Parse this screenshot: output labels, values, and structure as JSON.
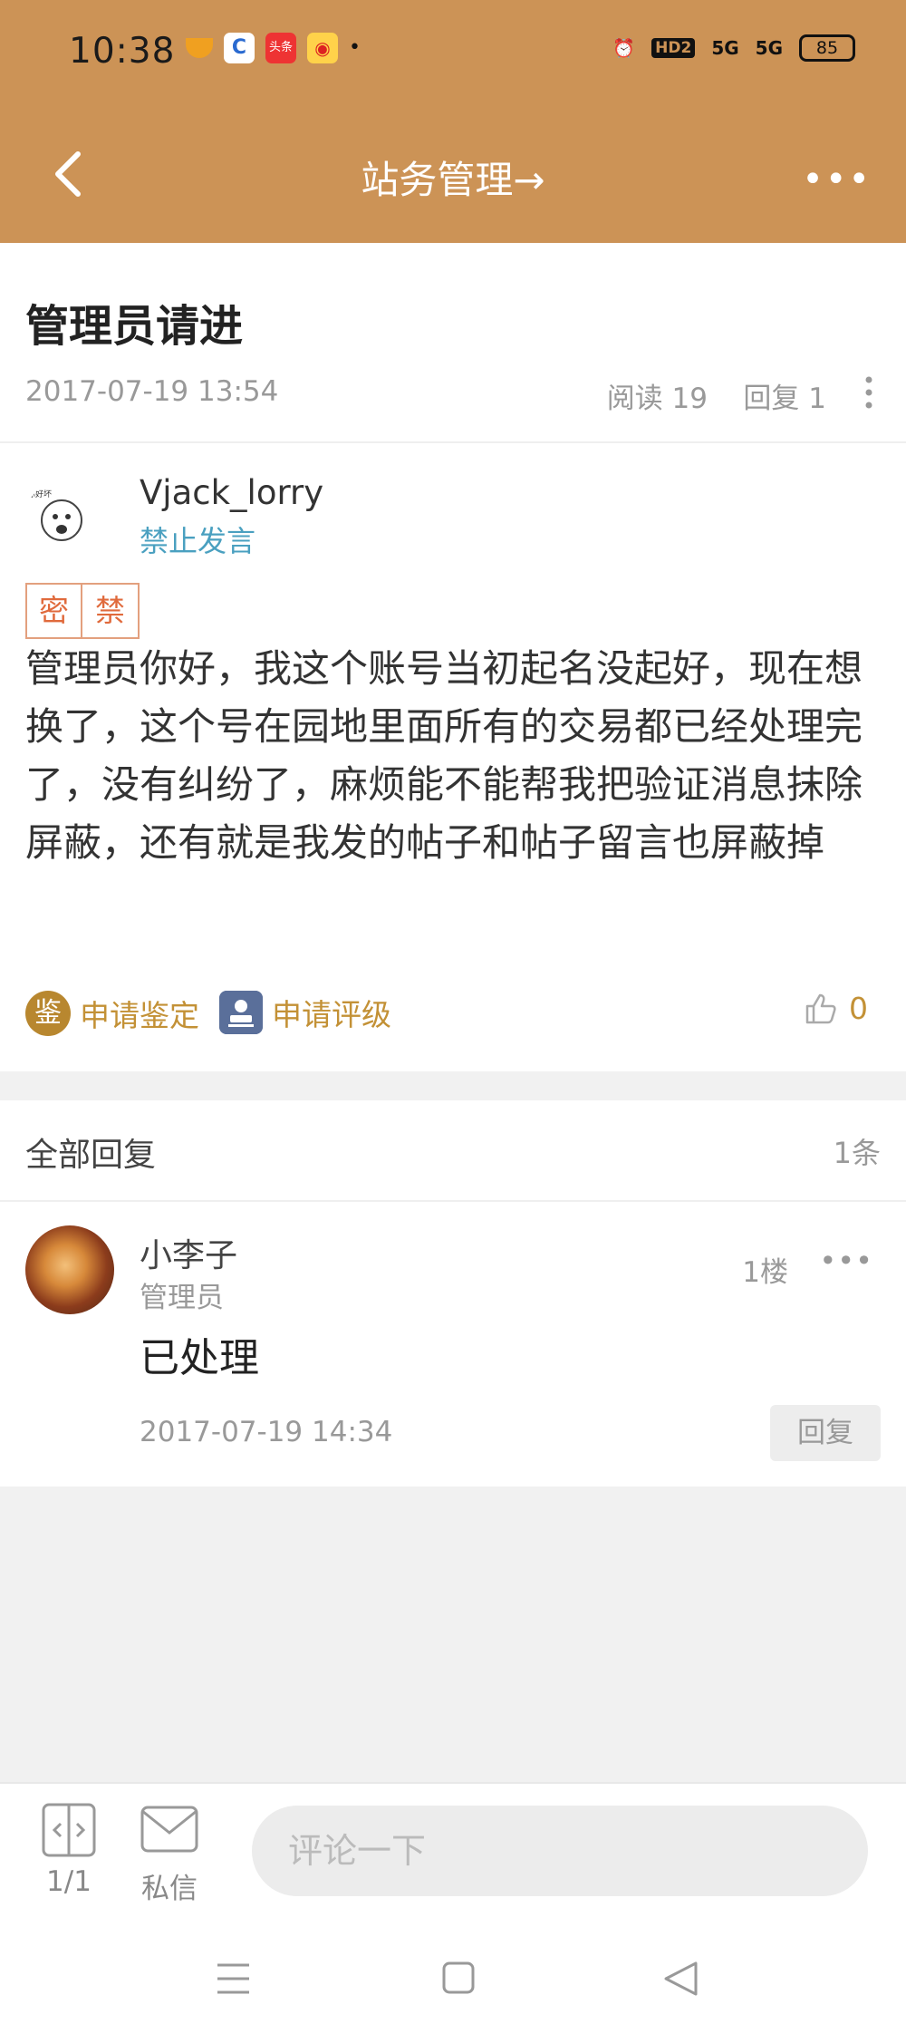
{
  "status_bar": {
    "time": "10:38",
    "battery": "85",
    "network_labels": [
      "HD2",
      "5G",
      "5G"
    ],
    "app_icons": [
      "notification-icon",
      "app-c-icon",
      "toutiao-icon",
      "weibo-icon"
    ],
    "toutiao_label": "头条"
  },
  "nav": {
    "title": "站务管理→"
  },
  "post": {
    "title": "管理员请进",
    "date": "2017-07-19 13:54",
    "reads": "阅读 19",
    "replies": "回复 1",
    "author": "Vjack_lorry",
    "author_status": "禁止发言",
    "tags": [
      "密",
      "禁"
    ],
    "content": "管理员你好，我这个账号当初起名没起好，现在想换了，这个号在园地里面所有的交易都已经处理完了，没有纠纷了，麻烦能不能帮我把验证消息抹除屏蔽，还有就是我发的帖子和帖子留言也屏蔽掉",
    "action_appraise": "申请鉴定",
    "action_appraise_icon": "鉴",
    "action_rate": "申请评级",
    "likes": "0"
  },
  "replies_section": {
    "header": "全部回复",
    "count": "1条",
    "items": [
      {
        "name": "小李子",
        "role": "管理员",
        "floor": "1楼",
        "text": "已处理",
        "time": "2017-07-19 14:34",
        "reply_label": "回复"
      }
    ]
  },
  "bottom_bar": {
    "page": "1/1",
    "message": "私信",
    "comment_placeholder": "评论一下"
  },
  "colors": {
    "header": "#cc9356",
    "accent_gold": "#c39136",
    "status_blue": "#4aa0c0",
    "tag_orange": "#e06a3c"
  }
}
